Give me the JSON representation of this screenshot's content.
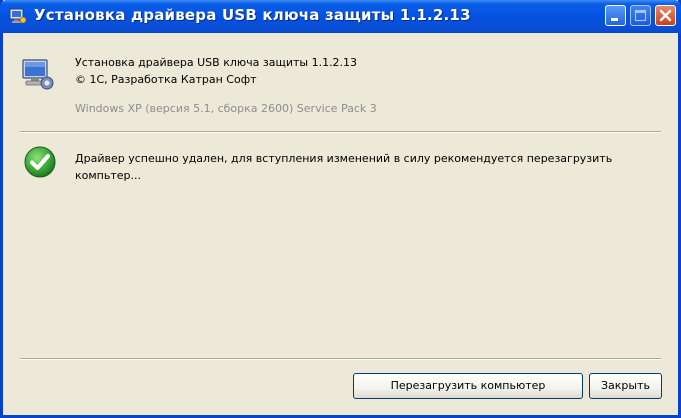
{
  "window": {
    "title": "Установка драйвера USB ключа защиты 1.1.2.13"
  },
  "header": {
    "product_line": "Установка драйвера USB ключа защиты 1.1.2.13",
    "copyright_line": "© 1С, Разработка Катран Софт",
    "os_info": "Windows XP (версия 5.1, сборка 2600) Service Pack 3",
    "icon": "computer-setup-icon"
  },
  "message": {
    "icon": "checkmark-success-icon",
    "text": "Драйвер успешно удален, для вступления изменений в силу рекомендуется перезагрузить компьтер..."
  },
  "buttons": {
    "restart_label": "Перезагрузить компьютер",
    "close_label": "Закрыть"
  },
  "colors": {
    "titlebar_blue": "#0553e2",
    "window_bg": "#ece9d8",
    "success_green": "#2e9b2e",
    "close_red": "#c8401a"
  }
}
